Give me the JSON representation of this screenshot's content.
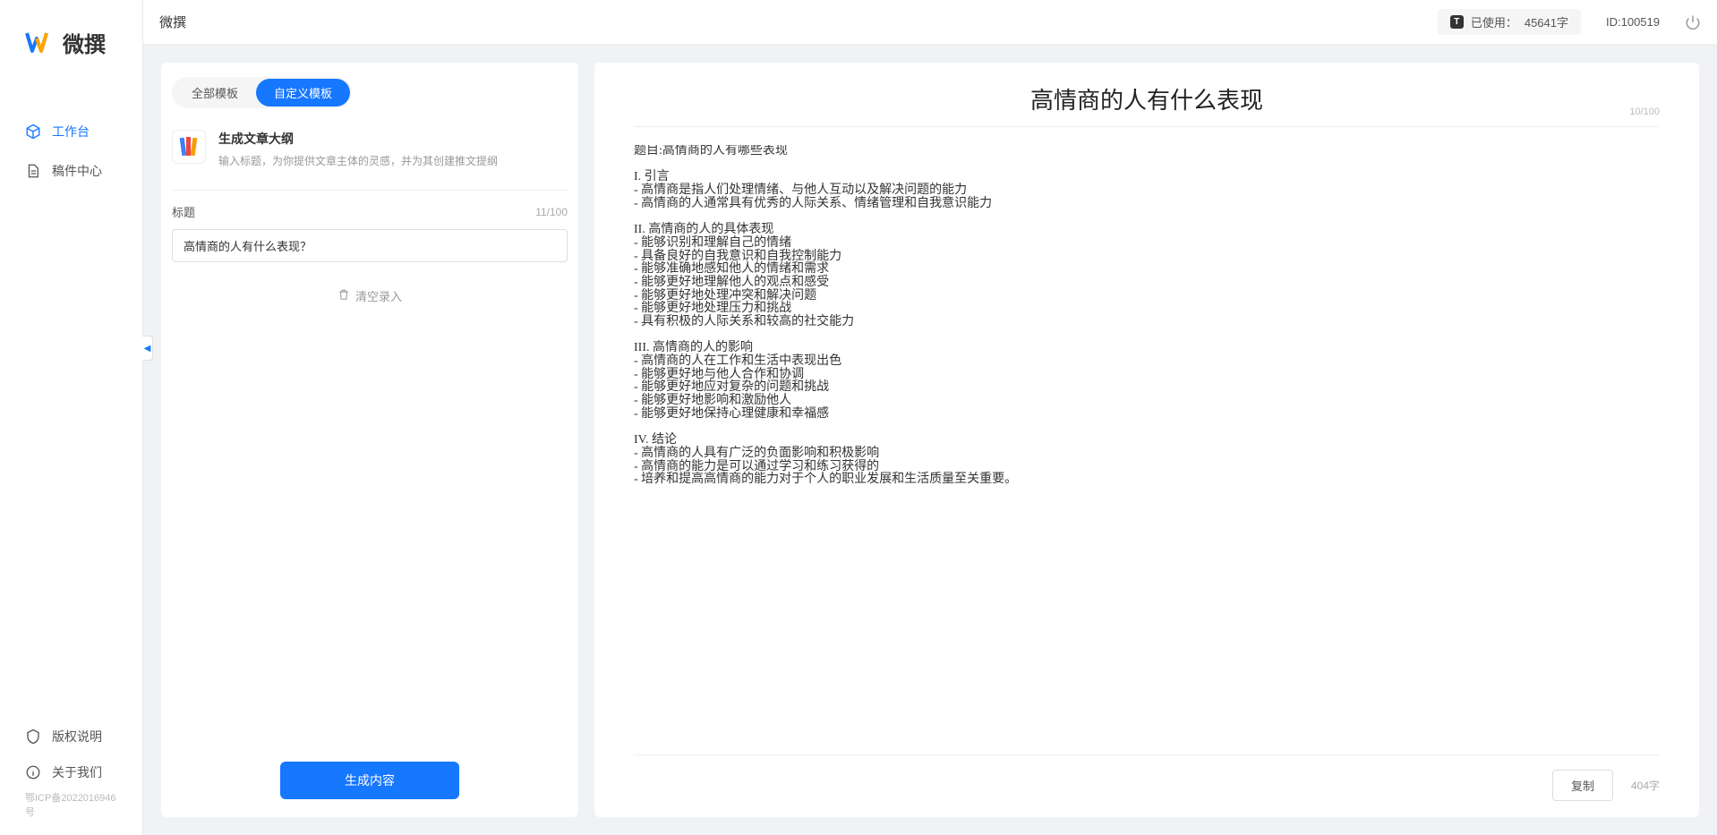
{
  "app": {
    "name": "微撰"
  },
  "sidebar": {
    "items": [
      {
        "label": "工作台",
        "icon": "cube"
      },
      {
        "label": "稿件中心",
        "icon": "document"
      }
    ],
    "footer_items": [
      {
        "label": "版权说明",
        "icon": "shield"
      },
      {
        "label": "关于我们",
        "icon": "info"
      }
    ],
    "icp": "鄂ICP备2022016946号"
  },
  "topbar": {
    "title": "微撰",
    "usage_prefix": "已使用：",
    "usage_value": "45641字",
    "user_id_label": "ID:100519"
  },
  "left": {
    "tabs": [
      {
        "label": "全部模板"
      },
      {
        "label": "自定义模板"
      }
    ],
    "template": {
      "title": "生成文章大纲",
      "desc": "输入标题，为你提供文章主体的灵感，并为其创建推文提纲"
    },
    "form": {
      "label": "标题",
      "char_count": "11/100",
      "input_value": "高情商的人有什么表现？",
      "clear_label": "清空录入"
    },
    "generate_label": "生成内容"
  },
  "output": {
    "title": "高情商的人有什么表现",
    "title_count": "10/100",
    "body": "题目:高情商的人有哪些表现\n\nI. 引言\n- 高情商是指人们处理情绪、与他人互动以及解决问题的能力\n- 高情商的人通常具有优秀的人际关系、情绪管理和自我意识能力\n\nII. 高情商的人的具体表现\n- 能够识别和理解自己的情绪\n- 具备良好的自我意识和自我控制能力\n- 能够准确地感知他人的情绪和需求\n- 能够更好地理解他人的观点和感受\n- 能够更好地处理冲突和解决问题\n- 能够更好地处理压力和挑战\n- 具有积极的人际关系和较高的社交能力\n\nIII. 高情商的人的影响\n- 高情商的人在工作和生活中表现出色\n- 能够更好地与他人合作和协调\n- 能够更好地应对复杂的问题和挑战\n- 能够更好地影响和激励他人\n- 能够更好地保持心理健康和幸福感\n\nIV. 结论\n- 高情商的人具有广泛的负面影响和积极影响\n- 高情商的能力是可以通过学习和练习获得的\n- 培养和提高高情商的能力对于个人的职业发展和生活质量至关重要。",
    "copy_label": "复制",
    "word_count": "404字"
  }
}
